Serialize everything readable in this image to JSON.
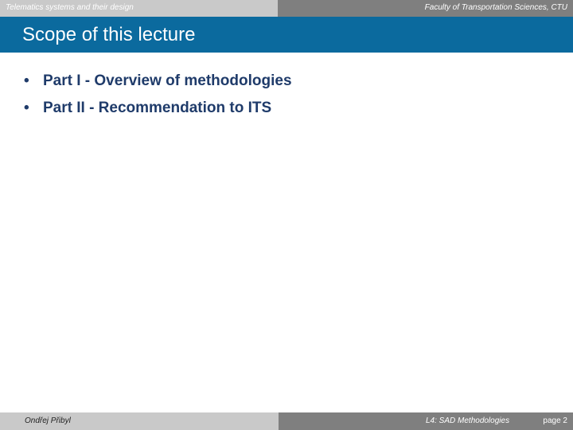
{
  "header": {
    "left_text": "Telematics systems and their design",
    "right_text": "Faculty of Transportation Sciences, CTU"
  },
  "title": "Scope of this lecture",
  "bullets": [
    {
      "marker": "•",
      "text": "Part I  - Overview of methodologies"
    },
    {
      "marker": "•",
      "text": "Part II  - Recommendation to ITS"
    }
  ],
  "footer": {
    "author": "Ondřej Přibyl",
    "course": "L4: SAD Methodologies",
    "page": "page 2"
  },
  "colors": {
    "header_left_bg": "#c9c9c9",
    "header_right_bg": "#7f7f7f",
    "title_bar_bg": "#0b6a9e",
    "bullet_text": "#1f3b6a"
  }
}
